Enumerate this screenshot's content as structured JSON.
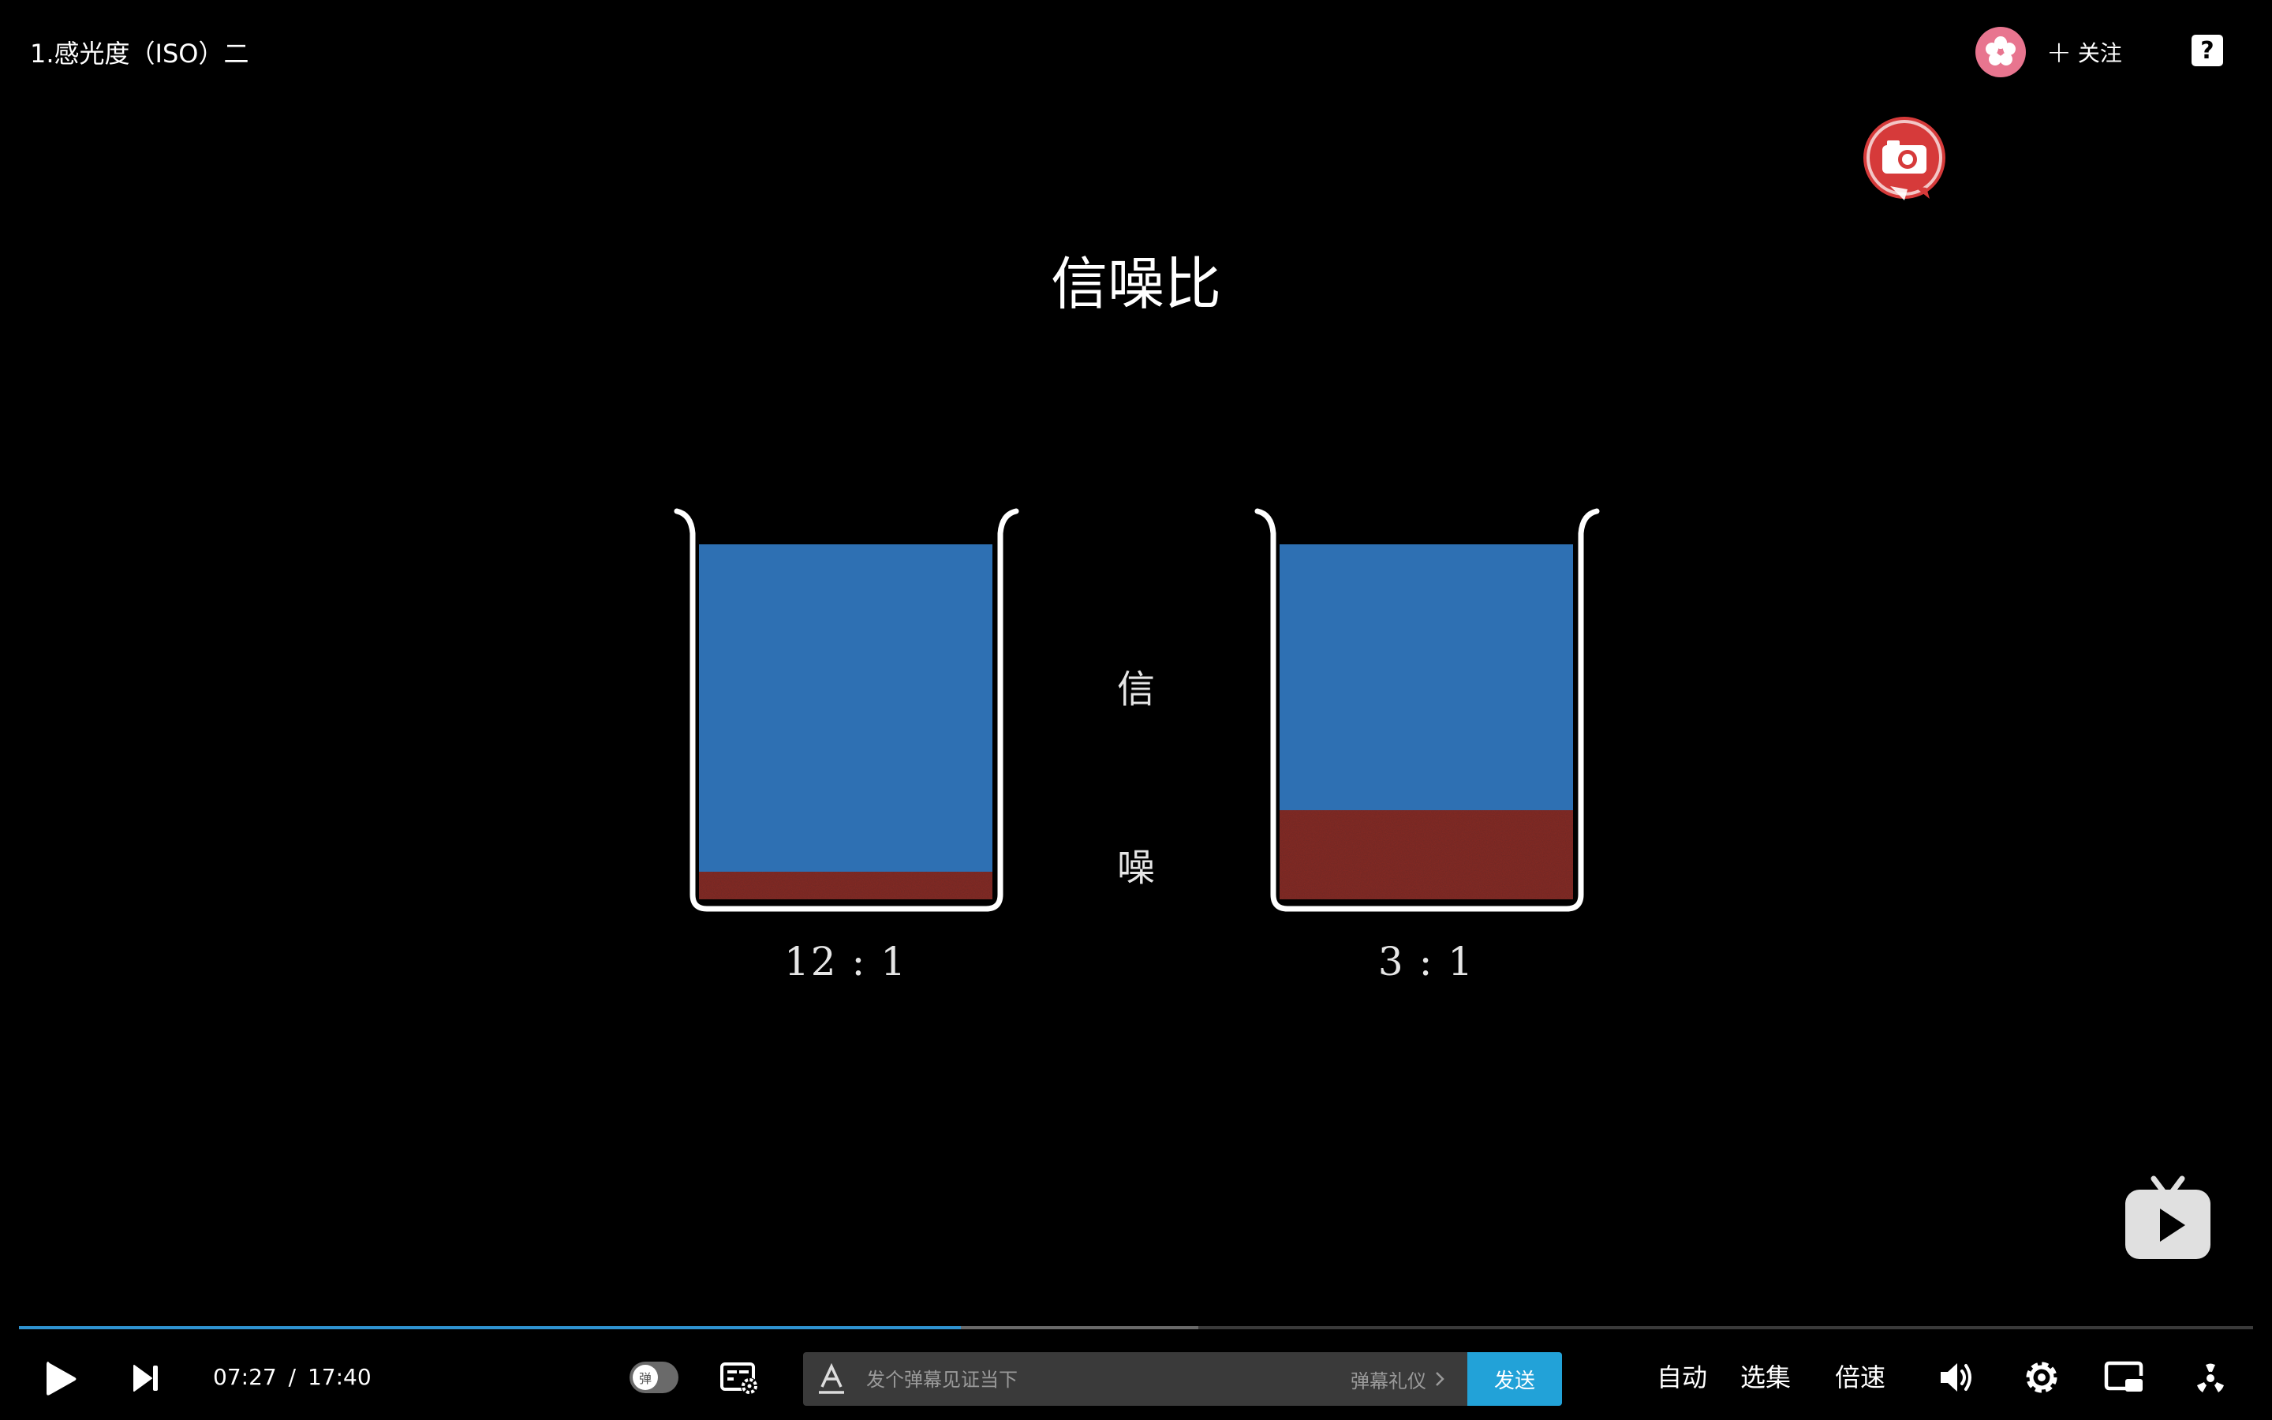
{
  "header": {
    "title": "1.感光度（ISO）二",
    "follow_label": "关注",
    "help_label": "?"
  },
  "video_frame": {
    "title": "信噪比",
    "label_signal": "信",
    "label_noise": "噪",
    "left_beaker": {
      "ratio": "12 : 1",
      "noise_fraction": 0.077
    },
    "right_beaker": {
      "ratio": "3 : 1",
      "noise_fraction": 0.25
    },
    "colors": {
      "signal": "#2e70b3",
      "noise": "#8e2a22",
      "outline": "#ffffff"
    }
  },
  "player": {
    "current_time": "07:27",
    "separator": "/",
    "duration": "17:40",
    "progress_fraction": 0.4216,
    "buffered_fraction": 0.528,
    "colors": {
      "progress": "#2f93d1",
      "send": "#22a2d8"
    }
  },
  "danmaku": {
    "toggle_glyph": "弹",
    "placeholder": "发个弹幕见证当下",
    "etiquette_label": "弹幕礼仪",
    "send_label": "发送"
  },
  "controls": {
    "auto_label": "自动",
    "episodes_label": "选集",
    "speed_label": "倍速"
  },
  "icons": [
    "play-icon",
    "next-icon",
    "danmaku-settings-icon",
    "text-style-icon",
    "chevron-right-icon",
    "volume-icon",
    "gear-icon",
    "picture-in-picture-icon",
    "fullscreen-icon",
    "tv-icon",
    "camera-badge-icon",
    "flower-avatar-icon"
  ]
}
